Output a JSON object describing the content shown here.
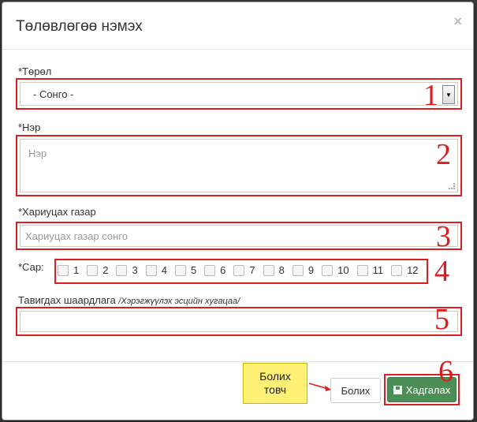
{
  "modal": {
    "title": "Төлөвлөгөө нэмэх",
    "close_glyph": "×"
  },
  "form": {
    "type": {
      "label": "*Төрөл",
      "value": "- Сонго -"
    },
    "name": {
      "label": "*Нэр",
      "placeholder": "Нэр"
    },
    "responsible": {
      "label": "*Хариуцах газар",
      "placeholder": "Хариуцах газар сонго"
    },
    "month": {
      "label": "*Сар:",
      "options": [
        "1",
        "2",
        "3",
        "4",
        "5",
        "6",
        "7",
        "8",
        "9",
        "10",
        "11",
        "12"
      ]
    },
    "requirement": {
      "label": "Тавигдах шаардлага",
      "hint": "/Хэрэгжүүлэх эсцийн хугацаа/",
      "value": ""
    }
  },
  "annotations": {
    "numbers": [
      "1",
      "2",
      "3",
      "4",
      "5",
      "6"
    ],
    "callout_line1": "Болих",
    "callout_line2": "товч",
    "highlight_color": "#d82020",
    "callout_color": "#fff176"
  },
  "footer": {
    "cancel_label": "Болих",
    "save_label": "Хадгалах",
    "save_icon": "floppy-disk-icon",
    "save_color": "#4b8e56"
  }
}
